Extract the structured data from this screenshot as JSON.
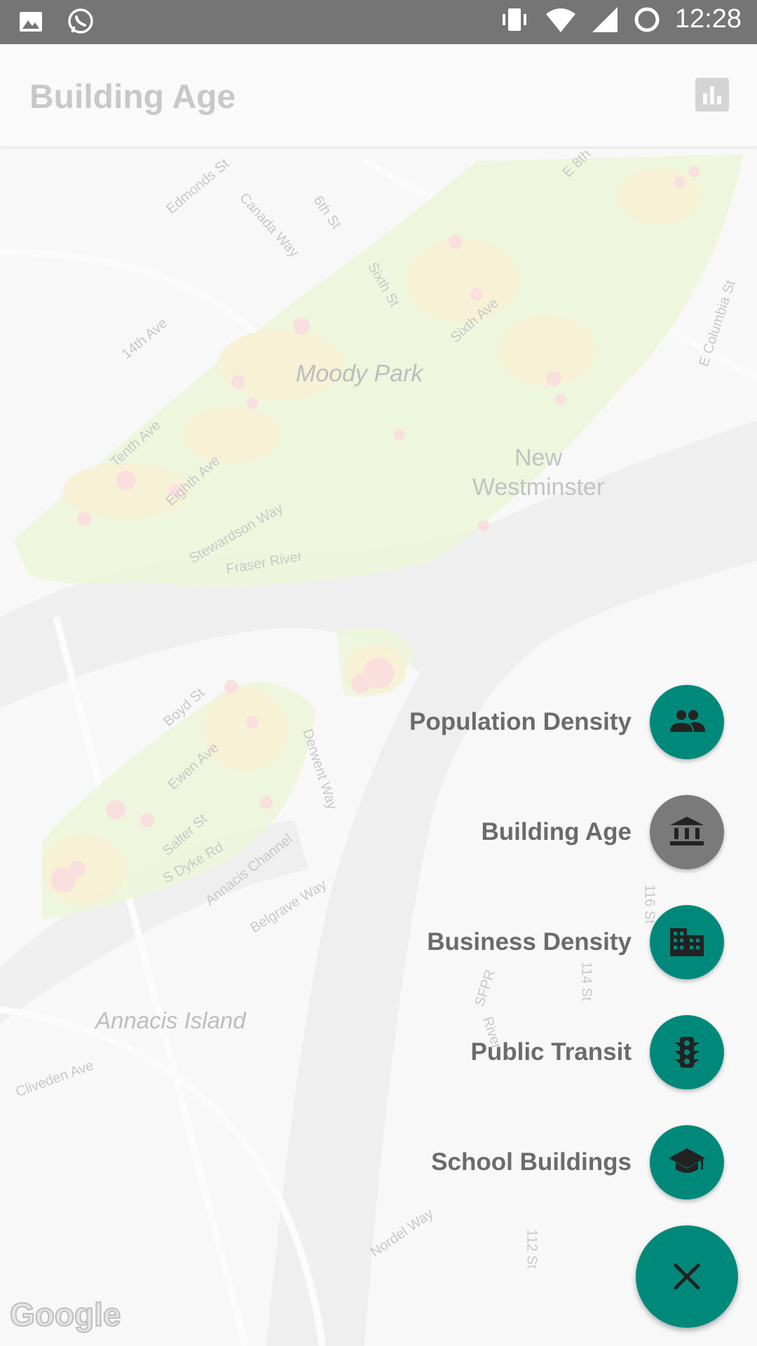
{
  "status_bar": {
    "time": "12:28",
    "icons": [
      "image-icon",
      "whatsapp-icon",
      "vibrate-icon",
      "wifi-icon",
      "signal-icon",
      "sync-icon"
    ]
  },
  "app_bar": {
    "title": "Building Age",
    "action_icon": "bar-chart-icon"
  },
  "map": {
    "area_labels": [
      "Moody Park",
      "Annacis Island"
    ],
    "city_label": [
      "New",
      "Westminster"
    ],
    "streets": [
      "Edmonds St",
      "Canada Way",
      "6th St",
      "E 8th",
      "Sixth St",
      "Sixth Ave",
      "14th Ave",
      "E Columbia St",
      "Tenth Ave",
      "Eighth Ave",
      "Stewardson Way",
      "Fraser River",
      "Boyd St",
      "Derwent Way",
      "Ewen Ave",
      "Salter St",
      "S Dyke Rd",
      "Annacis Channel",
      "Belgrave Way",
      "116 St",
      "114 St",
      "SFPR",
      "River",
      "Cliveden Ave",
      "Nordel Way",
      "112 St"
    ],
    "attribution": "Google"
  },
  "fab_menu": {
    "items": [
      {
        "label": "Population Density",
        "icon": "people-icon",
        "active": false
      },
      {
        "label": "Building Age",
        "icon": "bank-icon",
        "active": true
      },
      {
        "label": "Business Density",
        "icon": "business-icon",
        "active": false
      },
      {
        "label": "Public Transit",
        "icon": "traffic-icon",
        "active": false
      },
      {
        "label": "School Buildings",
        "icon": "school-icon",
        "active": false
      }
    ],
    "main_icon": "close-icon",
    "accent_color": "#00897b",
    "active_color": "#7a7a7a"
  }
}
